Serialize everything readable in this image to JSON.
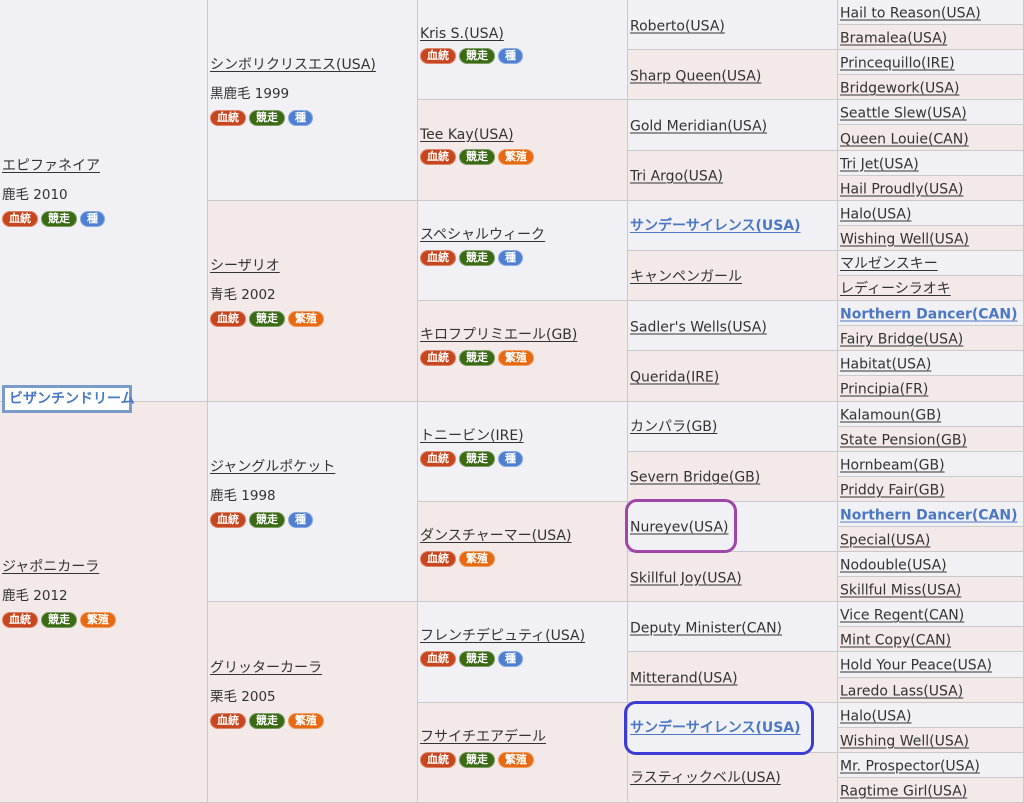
{
  "self_name": "ビザンチンドリーム",
  "tag_labels": {
    "ketto": "血統",
    "kyoso": "競走",
    "shu": "種",
    "hanshoku": "繁殖"
  },
  "gen1": [
    {
      "name": "エピファネイア",
      "info": "鹿毛 2010",
      "tags": [
        "ketto",
        "kyoso",
        "shu"
      ]
    },
    {
      "name": "ジャポニカーラ",
      "info": "鹿毛 2012",
      "tags": [
        "ketto",
        "kyoso",
        "hanshoku"
      ]
    }
  ],
  "gen2": [
    {
      "name": "シンボリクリスエス(USA)",
      "info": "黒鹿毛 1999",
      "tags": [
        "ketto",
        "kyoso",
        "shu"
      ]
    },
    {
      "name": "シーザリオ",
      "info": "青毛 2002",
      "tags": [
        "ketto",
        "kyoso",
        "hanshoku"
      ]
    },
    {
      "name": "ジャングルポケット",
      "info": "鹿毛 1998",
      "tags": [
        "ketto",
        "kyoso",
        "shu"
      ]
    },
    {
      "name": "グリッターカーラ",
      "info": "栗毛 2005",
      "tags": [
        "ketto",
        "kyoso",
        "hanshoku"
      ]
    }
  ],
  "gen3": [
    {
      "name": "Kris S.(USA)",
      "tags": [
        "ketto",
        "kyoso",
        "shu"
      ]
    },
    {
      "name": "Tee Kay(USA)",
      "tags": [
        "ketto",
        "kyoso",
        "hanshoku"
      ]
    },
    {
      "name": "スペシャルウィーク",
      "tags": [
        "ketto",
        "kyoso",
        "shu"
      ]
    },
    {
      "name": "キロフプリミエール(GB)",
      "tags": [
        "ketto",
        "kyoso",
        "hanshoku"
      ]
    },
    {
      "name": "トニービン(IRE)",
      "tags": [
        "ketto",
        "kyoso",
        "shu"
      ]
    },
    {
      "name": "ダンスチャーマー(USA)",
      "tags": [
        "ketto",
        "hanshoku"
      ]
    },
    {
      "name": "フレンチデピュティ(USA)",
      "tags": [
        "ketto",
        "kyoso",
        "shu"
      ]
    },
    {
      "name": "フサイチエアデール",
      "tags": [
        "ketto",
        "kyoso",
        "hanshoku"
      ]
    }
  ],
  "gen4": [
    {
      "name": "Roberto(USA)"
    },
    {
      "name": "Sharp Queen(USA)"
    },
    {
      "name": "Gold Meridian(USA)"
    },
    {
      "name": "Tri Argo(USA)"
    },
    {
      "name": "サンデーサイレンス(USA)",
      "highlight": true
    },
    {
      "name": "キャンペンガール"
    },
    {
      "name": "Sadler's Wells(USA)"
    },
    {
      "name": "Querida(IRE)"
    },
    {
      "name": "カンパラ(GB)"
    },
    {
      "name": "Severn Bridge(GB)"
    },
    {
      "name": "Nureyev(USA)"
    },
    {
      "name": "Skillful Joy(USA)"
    },
    {
      "name": "Deputy Minister(CAN)"
    },
    {
      "name": "Mitterand(USA)"
    },
    {
      "name": "サンデーサイレンス(USA)",
      "highlight": true
    },
    {
      "name": "ラスティックベル(USA)"
    }
  ],
  "gen5": [
    {
      "name": "Hail to Reason(USA)"
    },
    {
      "name": "Bramalea(USA)"
    },
    {
      "name": "Princequillo(IRE)"
    },
    {
      "name": "Bridgework(USA)"
    },
    {
      "name": "Seattle Slew(USA)"
    },
    {
      "name": "Queen Louie(CAN)"
    },
    {
      "name": "Tri Jet(USA)"
    },
    {
      "name": "Hail Proudly(USA)"
    },
    {
      "name": "Halo(USA)"
    },
    {
      "name": "Wishing Well(USA)"
    },
    {
      "name": "マルゼンスキー"
    },
    {
      "name": "レディーシラオキ"
    },
    {
      "name": "Northern Dancer(CAN)",
      "highlight": true
    },
    {
      "name": "Fairy Bridge(USA)"
    },
    {
      "name": "Habitat(USA)"
    },
    {
      "name": "Principia(FR)"
    },
    {
      "name": "Kalamoun(GB)"
    },
    {
      "name": "State Pension(GB)"
    },
    {
      "name": "Hornbeam(GB)"
    },
    {
      "name": "Priddy Fair(GB)"
    },
    {
      "name": "Northern Dancer(CAN)",
      "highlight": true
    },
    {
      "name": "Special(USA)"
    },
    {
      "name": "Nodouble(USA)"
    },
    {
      "name": "Skillful Miss(USA)"
    },
    {
      "name": "Vice Regent(CAN)"
    },
    {
      "name": "Mint Copy(CAN)"
    },
    {
      "name": "Hold Your Peace(USA)"
    },
    {
      "name": "Laredo Lass(USA)"
    },
    {
      "name": "Halo(USA)"
    },
    {
      "name": "Wishing Well(USA)"
    },
    {
      "name": "Mr. Prospector(USA)"
    },
    {
      "name": "Ragtime Girl(USA)"
    }
  ],
  "colors": {
    "sire_bg": "#f1f0f4",
    "dam_bg": "#f3e9e9",
    "link_highlight": "#4a78c6",
    "circle_purple": "#a046a8",
    "circle_blue": "#3c3cd2"
  }
}
